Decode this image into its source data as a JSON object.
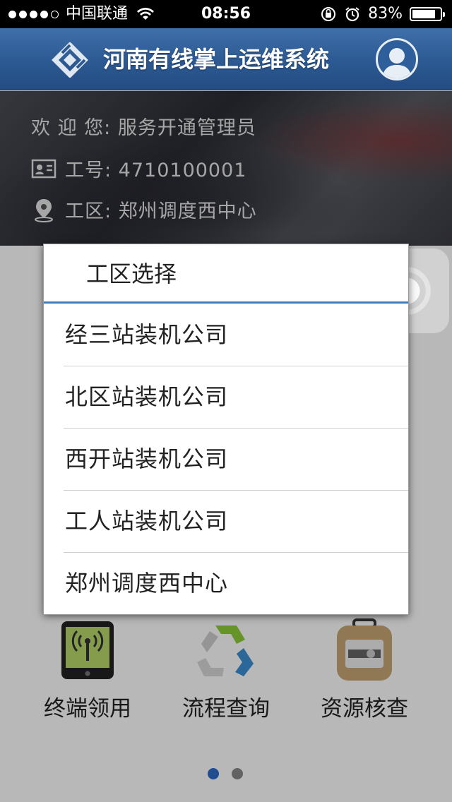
{
  "status_bar": {
    "signal_dots": [
      true,
      true,
      true,
      true,
      false
    ],
    "carrier": "中国联通",
    "wifi_icon": "wifi-icon",
    "time": "08:56",
    "rotation_lock_icon": "rotation-lock-icon",
    "alarm_icon": "alarm-icon",
    "battery_percent": "83%",
    "battery_level": 0.83
  },
  "header": {
    "logo_icon": "app-logo-icon",
    "title": "河南有线掌上运维系统",
    "avatar_icon": "user-avatar-icon",
    "color": "#2c5992"
  },
  "profile": {
    "welcome": "欢 迎 您: 服务开通管理员",
    "employee_id": "工号: 4710100001",
    "work_area": "工区: 郑州调度西中心",
    "id_card_icon": "id-card-icon",
    "location_icon": "location-pin-icon"
  },
  "dialog": {
    "title": "工区选择",
    "accent": "#3d7fbf",
    "options": [
      "经三站装机公司",
      "北区站装机公司",
      "西开站装机公司",
      "工人站装机公司",
      "郑州调度西中心"
    ]
  },
  "grid": {
    "items": [
      {
        "label": "终端领用",
        "icon": "terminal-device-icon"
      },
      {
        "label": "流程查询",
        "icon": "recycle-process-icon"
      },
      {
        "label": "资源核查",
        "icon": "resource-case-icon"
      }
    ]
  },
  "pager": {
    "pages": 2,
    "current": 1
  },
  "assistive_touch": {
    "icon": "assistive-touch-icon"
  }
}
